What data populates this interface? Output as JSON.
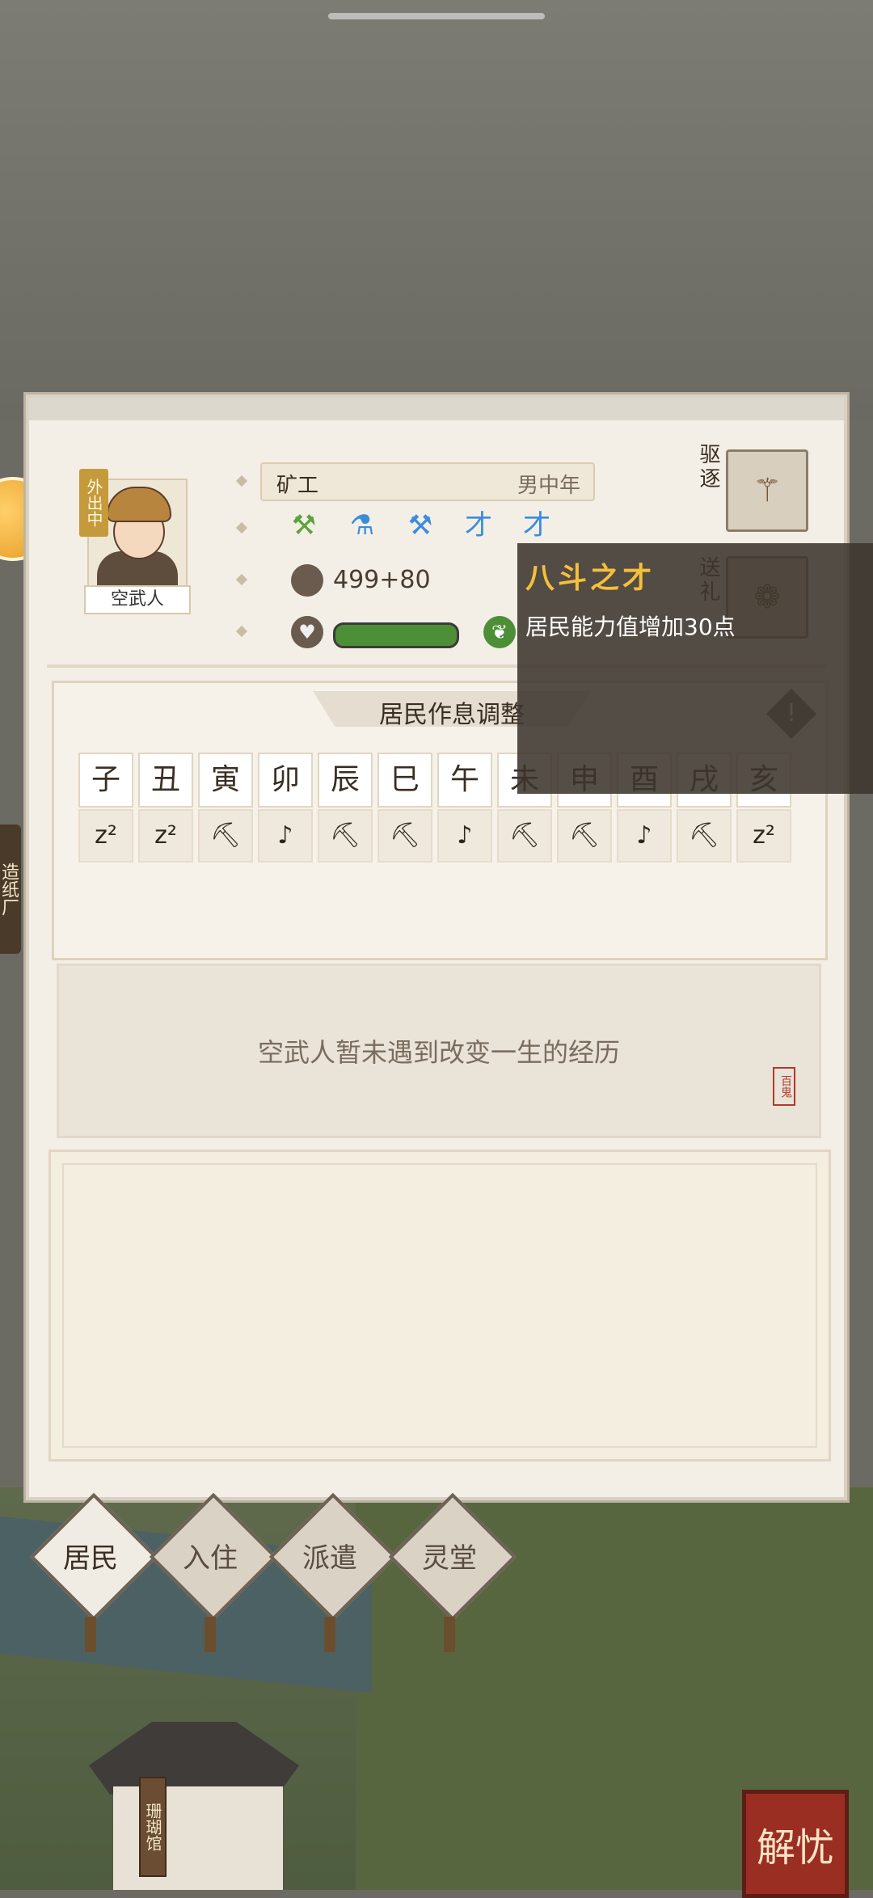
{
  "resident": {
    "name": "空武人",
    "status_badge": "外出中",
    "profession": "矿工",
    "gender_age": "男中年",
    "coins": "499+80"
  },
  "actions": {
    "expel_label": "驱逐",
    "gift_label": "送礼"
  },
  "skills": [
    {
      "icon": "pickaxe-icon",
      "glyph": "⚒",
      "color": "#5aa43a"
    },
    {
      "icon": "alchemy-icon",
      "glyph": "⚗",
      "color": "#3b8ddb"
    },
    {
      "icon": "pickaxe-icon",
      "glyph": "⚒",
      "color": "#3b8ddb"
    },
    {
      "icon": "talent-icon",
      "glyph": "才",
      "color": "#3b8ddb"
    },
    {
      "icon": "talent-icon",
      "glyph": "才",
      "color": "#3b8ddb"
    }
  ],
  "schedule": {
    "title": "居民作息调整",
    "hours": [
      "子",
      "丑",
      "寅",
      "卯",
      "辰",
      "巳",
      "午",
      "未",
      "申",
      "酉",
      "戌",
      "亥"
    ],
    "activities": [
      "z²",
      "z²",
      "⛏",
      "♪",
      "⛏",
      "⛏",
      "♪",
      "⛏",
      "⛏",
      "♪",
      "⛏",
      "z²"
    ]
  },
  "history": {
    "text": "空武人暂未遇到改变一生的经历",
    "seal": "百鬼"
  },
  "tooltip": {
    "title": "八斗之才",
    "desc": "居民能力值增加30点"
  },
  "nav": {
    "tabs": [
      "居民",
      "入住",
      "派遣",
      "灵堂"
    ],
    "active_index": 0
  },
  "scene": {
    "side_tab": "造纸厂",
    "building_sign": "珊瑚馆",
    "corner_badge": "解忧"
  }
}
